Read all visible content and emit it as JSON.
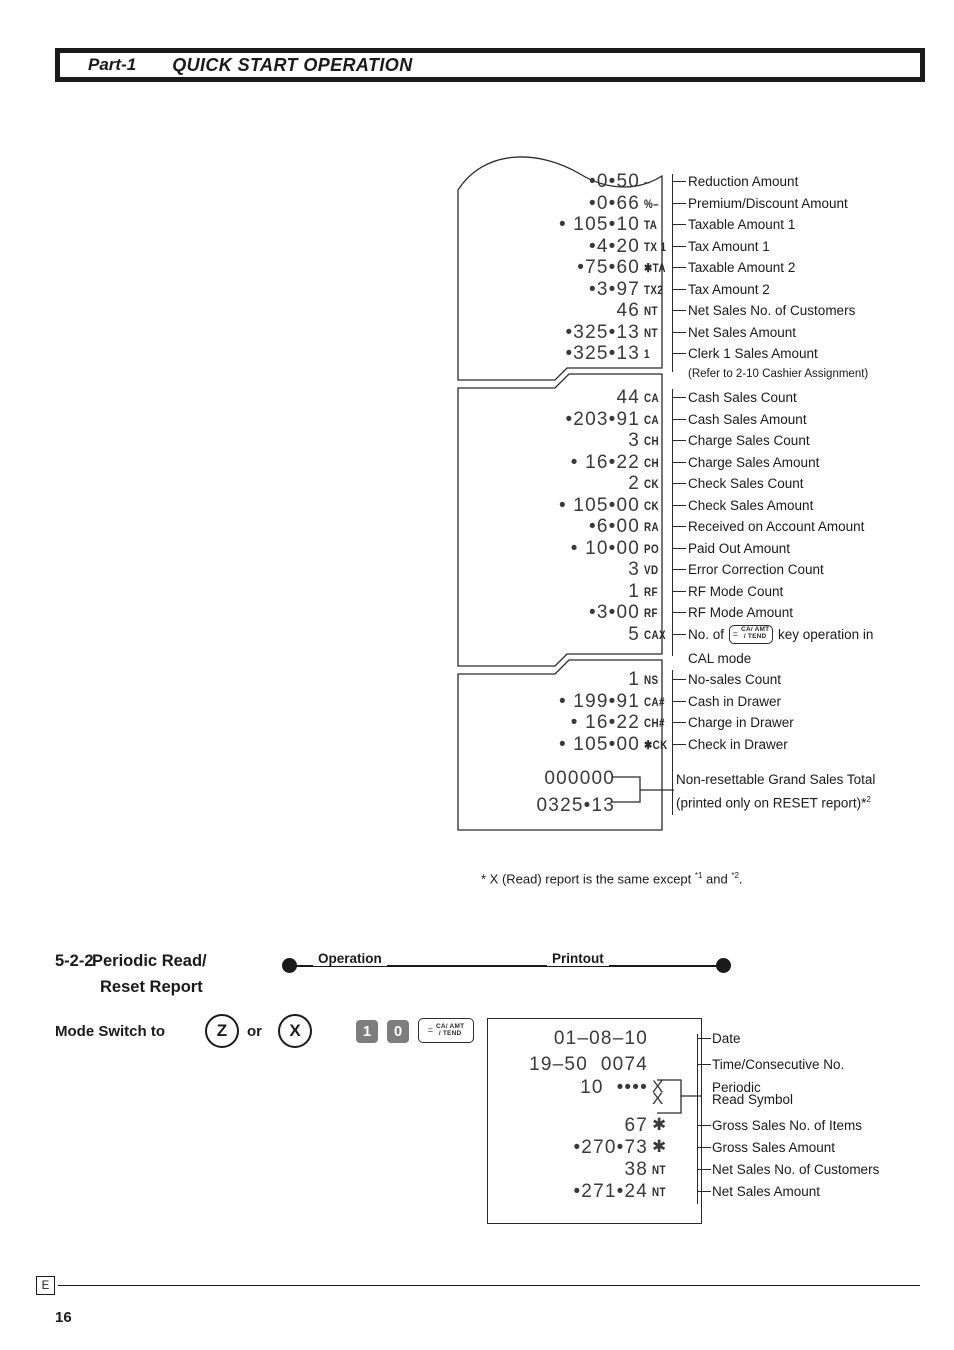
{
  "header": {
    "part": "Part-1",
    "title": "QUICK START OPERATION"
  },
  "reset_report": {
    "segment1": [
      {
        "amount": "•0•50",
        "symbol": "–",
        "label": "Reduction Amount"
      },
      {
        "amount": "•0•66",
        "symbol": "%–",
        "label": "Premium/Discount Amount"
      },
      {
        "amount": "• 105•10",
        "symbol": "TA",
        "label": "Taxable Amount 1"
      },
      {
        "amount": "•4•20",
        "symbol": "TX 1",
        "label": "Tax Amount 1"
      },
      {
        "amount": "•75•60",
        "symbol": "✱TA",
        "label": "Taxable Amount 2"
      },
      {
        "amount": "•3•97",
        "symbol": "TX2",
        "label": "Tax Amount 2"
      },
      {
        "amount": "46",
        "symbol": "NT",
        "label": "Net Sales No. of Customers"
      },
      {
        "amount": "•325•13",
        "symbol": "NT",
        "label": "Net Sales Amount"
      },
      {
        "amount": "•325•13",
        "symbol": "1",
        "label": "Clerk 1 Sales Amount"
      }
    ],
    "clerk_note": "(Refer to 2-10 Cashier Assignment)",
    "segment2": [
      {
        "amount": "44",
        "symbol": "CA",
        "label": "Cash Sales Count"
      },
      {
        "amount": "•203•91",
        "symbol": "CA",
        "label": "Cash Sales Amount"
      },
      {
        "amount": "3",
        "symbol": "CH",
        "label": "Charge Sales Count"
      },
      {
        "amount": "• 16•22",
        "symbol": "CH",
        "label": "Charge Sales Amount"
      },
      {
        "amount": "2",
        "symbol": "CK",
        "label": "Check Sales Count"
      },
      {
        "amount": "• 105•00",
        "symbol": "CK",
        "label": "Check Sales Amount"
      },
      {
        "amount": "•6•00",
        "symbol": "RA",
        "label": "Received on Account Amount"
      },
      {
        "amount": "• 10•00",
        "symbol": "PO",
        "label": "Paid Out Amount"
      },
      {
        "amount": "3",
        "symbol": "VD",
        "label": "Error Correction Count"
      },
      {
        "amount": "1",
        "symbol": "RF",
        "label": "RF Mode Count"
      },
      {
        "amount": "•3•00",
        "symbol": "RF",
        "label": "RF Mode Amount"
      },
      {
        "amount": "5",
        "symbol": "CAX",
        "label": ""
      }
    ],
    "cax_label_pre": "No. of",
    "cax_label_post": "key operation in",
    "cax_label_line2": "CAL mode",
    "segment3": [
      {
        "amount": "1",
        "symbol": "NS",
        "label": "No-sales Count"
      },
      {
        "amount": "• 199•91",
        "symbol": "CA#",
        "label": "Cash in Drawer"
      },
      {
        "amount": "• 16•22",
        "symbol": "CH#",
        "label": "Charge in Drawer"
      },
      {
        "amount": "• 105•00",
        "symbol": "✱CK",
        "label": "Check in Drawer"
      }
    ],
    "grand_total": {
      "line1": "000000",
      "line2": "0325•13",
      "label_line1": "Non-resettable Grand Sales Total",
      "label_line2": "(printed only on RESET report)*",
      "label_sup": "2"
    },
    "footnote_pre": "* X (Read) report is the same except ",
    "footnote_sup1": "*1",
    "footnote_mid": " and ",
    "footnote_sup2": "*2",
    "footnote_end": "."
  },
  "section": {
    "number": "5-2-2",
    "title_line1": "Periodic Read/",
    "title_line2": "Reset Report",
    "mode_switch_text": "Mode Switch to",
    "mode_z": "Z",
    "mode_or": "or",
    "mode_x": "X",
    "keys": [
      "1",
      "0"
    ],
    "key_ca_eq": "=",
    "key_ca_top": "CA/ AMT",
    "key_ca_bottom": "/ TEND",
    "rail_operation": "Operation",
    "rail_printout": "Printout"
  },
  "periodic_report": {
    "lines": [
      {
        "amount": "01–08–10",
        "symbol": "",
        "label": "Date"
      },
      {
        "amount": "19–50  0074",
        "symbol": "",
        "label": "Time/Consecutive No."
      },
      {
        "amount": "10  ••••",
        "symbol": "X",
        "label": "Periodic"
      },
      {
        "amount": "",
        "symbol": "X",
        "label": "Read Symbol"
      },
      {
        "amount": "67",
        "symbol": "✱",
        "label": "Gross Sales No. of Items"
      },
      {
        "amount": "•270•73",
        "symbol": "✱",
        "label": "Gross Sales Amount"
      },
      {
        "amount": "38",
        "symbol": "NT",
        "label": "Net Sales No. of Customers"
      },
      {
        "amount": "•271•24",
        "symbol": "NT",
        "label": "Net Sales Amount"
      }
    ]
  },
  "footer": {
    "lang_mark": "E",
    "page_number": "16"
  }
}
